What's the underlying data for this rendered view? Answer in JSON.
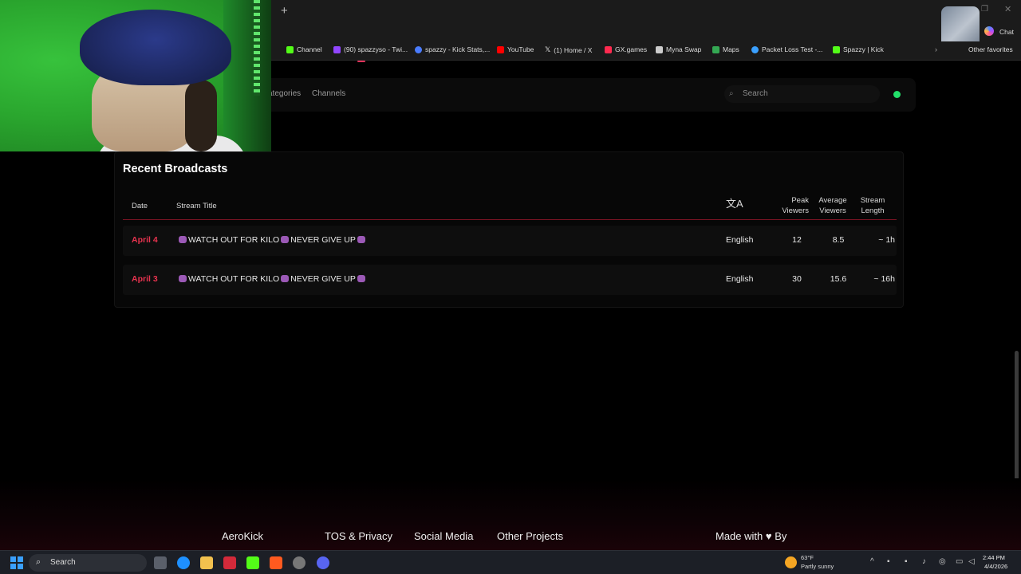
{
  "browser": {
    "new_tab": "+",
    "chat_label": "Chat",
    "other_favorites": "Other favorites",
    "bookmarks": [
      {
        "label": "Channel",
        "color": "#53fc18"
      },
      {
        "label": "(90) spazzyso - Twi...",
        "color": "#9146ff"
      },
      {
        "label": "spazzy - Kick Stats,...",
        "color": "#4a7cff"
      },
      {
        "label": "YouTube",
        "color": "#ff0000"
      },
      {
        "label": "(1) Home / X",
        "color": "#e7e7e7"
      },
      {
        "label": "GX.games",
        "color": "#ff2a4f"
      },
      {
        "label": "Myna Swap",
        "color": "#cccccc"
      },
      {
        "label": "Maps",
        "color": "#34a853"
      },
      {
        "label": "Packet Loss Test -...",
        "color": "#3aa0ff"
      },
      {
        "label": "Spazzy | Kick",
        "color": "#53fc18"
      }
    ]
  },
  "nav": {
    "categories": "ategories",
    "channels": "Channels",
    "search_placeholder": "Search"
  },
  "broadcasts": {
    "title": "Recent Broadcasts",
    "headers": {
      "date": "Date",
      "stream_title": "Stream Title",
      "language_icon": "translate-icon",
      "peak_1": "Peak",
      "peak_2": "Viewers",
      "avg_1": "Average",
      "avg_2": "Viewers",
      "len_1": "Stream",
      "len_2": "Length"
    },
    "rows": [
      {
        "date": "April 4",
        "title_a": "WATCH OUT FOR KILO",
        "title_b": "NEVER GIVE UP",
        "language": "English",
        "peak": "12",
        "average": "8.5",
        "length": "~ 1h"
      },
      {
        "date": "April 3",
        "title_a": "WATCH OUT FOR KILO",
        "title_b": "NEVER GIVE UP",
        "language": "English",
        "peak": "30",
        "average": "15.6",
        "length": "~ 16h"
      }
    ]
  },
  "footer": {
    "brand": "AeroKick",
    "tos": "TOS & Privacy",
    "social": "Social Media",
    "projects": "Other Projects",
    "made_with": "Made with",
    "by": "By"
  },
  "taskbar": {
    "search": "Search",
    "weather_temp": "63°F",
    "weather_desc": "Partly sunny",
    "time": "2:44 PM",
    "date": "4/4/2026"
  },
  "colors": {
    "accent_red": "#e8334f",
    "live_green": "#22e06a",
    "background": "#000000"
  }
}
